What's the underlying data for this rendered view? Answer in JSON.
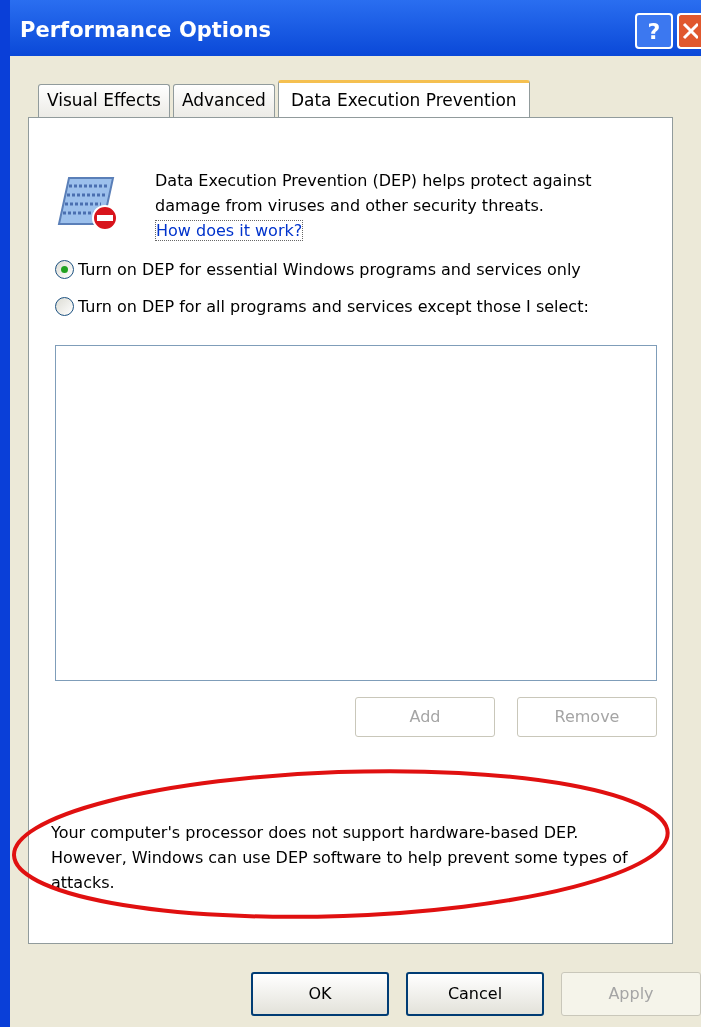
{
  "window": {
    "title": "Performance Options",
    "help_button": "?"
  },
  "tabs": [
    {
      "label": "Visual Effects",
      "selected": false
    },
    {
      "label": "Advanced",
      "selected": false
    },
    {
      "label": "Data Execution Prevention",
      "selected": true
    }
  ],
  "description": {
    "text": "Data Execution Prevention (DEP) helps protect against damage from viruses and other security threats.",
    "link": "How does it work?"
  },
  "options": [
    {
      "label": "Turn on DEP for essential Windows programs and services only",
      "selected": true
    },
    {
      "label": "Turn on DEP for all programs and services except those I select:",
      "selected": false
    }
  ],
  "list_buttons": [
    {
      "label": "Add",
      "disabled": true
    },
    {
      "label": "Remove",
      "disabled": true
    }
  ],
  "note": "Your computer's processor does not support hardware-based DEP. However, Windows can use DEP software to help prevent some types of attacks.",
  "buttons": [
    {
      "label": "OK",
      "disabled": false
    },
    {
      "label": "Cancel",
      "disabled": false
    },
    {
      "label": "Apply",
      "disabled": true
    }
  ]
}
